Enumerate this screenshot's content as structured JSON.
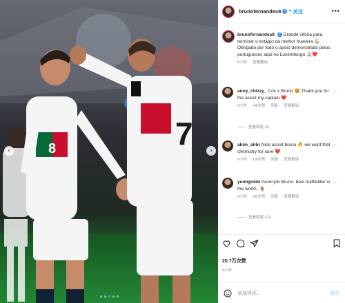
{
  "header": {
    "username": "brunofernandes8",
    "follow_separator": "•",
    "follow_label": "关注",
    "more_label": "•••"
  },
  "caption": {
    "username": "brunofernandes8",
    "text": "Grande vitória para terminar o estágio da melhor maneira 💪🏼 Obrigado por todo o apoio demonstrado pelos portugueses aqui no Luxemburgo 🙏🏼❤️",
    "time": "6小时",
    "translate": "查看翻译"
  },
  "comments": [
    {
      "username": "anny_chizzy_",
      "text": "Cris x Bruno 🤩 Thank you for the assist my captain ❤️",
      "time": "6小时",
      "likes": "44l次赞",
      "reply": "回复",
      "translate": "查看翻译",
      "replies": "查看回复 (3)"
    },
    {
      "username": "akim_ahbr",
      "text": "Nice assist bruno 🔥 we want that chemistry for sure ❤️",
      "time": "6小时",
      "likes": "19l次赞",
      "reply": "回复",
      "translate": "查看翻译",
      "replies": ""
    },
    {
      "username": "yemigoldd",
      "text": "Good job Bruno. best midfielder in the world...🐐",
      "time": "6小时",
      "likes": "42l次赞",
      "reply": "回复",
      "translate": "查看翻译",
      "replies": "查看回复 (12)"
    }
  ],
  "post": {
    "likes": "20.7万次赞",
    "time": "6小时",
    "comment_placeholder": "添加评论...",
    "post_label": "发布"
  },
  "photo": {
    "jersey_left_number": "8",
    "jersey_right_number": "7",
    "carousel_dots": 5,
    "active_dot": 3
  },
  "icons": {
    "like": "heart-icon",
    "comment": "comment-icon",
    "share": "share-icon",
    "save": "bookmark-icon",
    "emoji": "emoji-icon"
  },
  "colors": {
    "accent": "#0095f6",
    "verified": "#3897f0",
    "muted": "#8e8e8e",
    "portugal_red": "#c8102e",
    "portugal_green": "#046a38"
  }
}
